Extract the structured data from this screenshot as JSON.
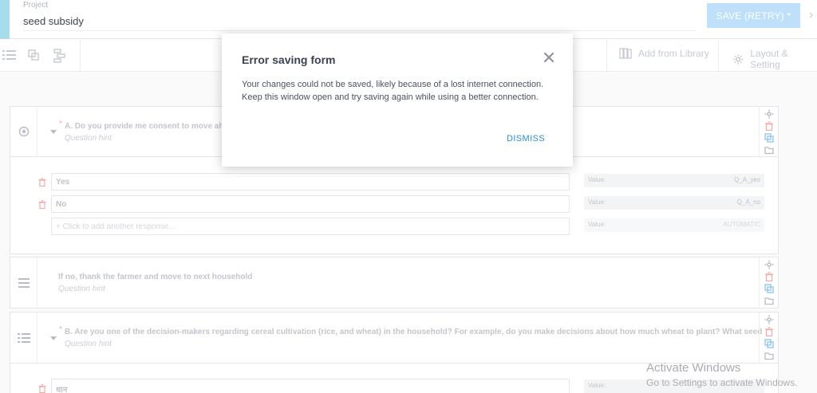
{
  "header": {
    "project_label": "Project",
    "project_name": "seed subsidy",
    "save_label": "SAVE (RETRY) *"
  },
  "toolbar": {
    "add_from_library": "Add from Library",
    "layout_settings": "Layout & Setting"
  },
  "questions": [
    {
      "title": "A. Do you provide me consent to move ahe",
      "hint": "Question hint",
      "required": true,
      "icon": "radio-icon",
      "choices": [
        {
          "label": "Yes",
          "value_label": "Value:",
          "value": "Q_A_yes"
        },
        {
          "label": "No",
          "value_label": "Value:",
          "value": "Q_A_no"
        }
      ],
      "add_choice": "+ Click to add another response...",
      "add_value_label": "Value:",
      "add_value": "AUTOMATIC"
    },
    {
      "title": "If no, thank the farmer and move to next household",
      "hint": "Question hint",
      "icon": "note-icon"
    },
    {
      "title": "B. Are you one of the decision-makers regarding cereal cultivation (rice, and wheat) in the household? For example, do you make decisions about how much wheat to plant? What seed",
      "hint": "Question hint",
      "required": true,
      "icon": "select-multiple-icon",
      "first_choice": "धान",
      "first_value_label": "Value:"
    }
  ],
  "dialog": {
    "title": "Error saving form",
    "message": "Your changes could not be saved, likely because of a lost internet connection. Keep this window open and try saving again while using a better connection.",
    "dismiss_label": "DISMISS"
  },
  "watermark": {
    "title": "Activate Windows",
    "subtitle": "Go to Settings to activate Windows."
  },
  "colors": {
    "accent_strip": "#a7ddea",
    "save_button": "#bfe0fb",
    "link_blue": "#2a8fd6"
  }
}
